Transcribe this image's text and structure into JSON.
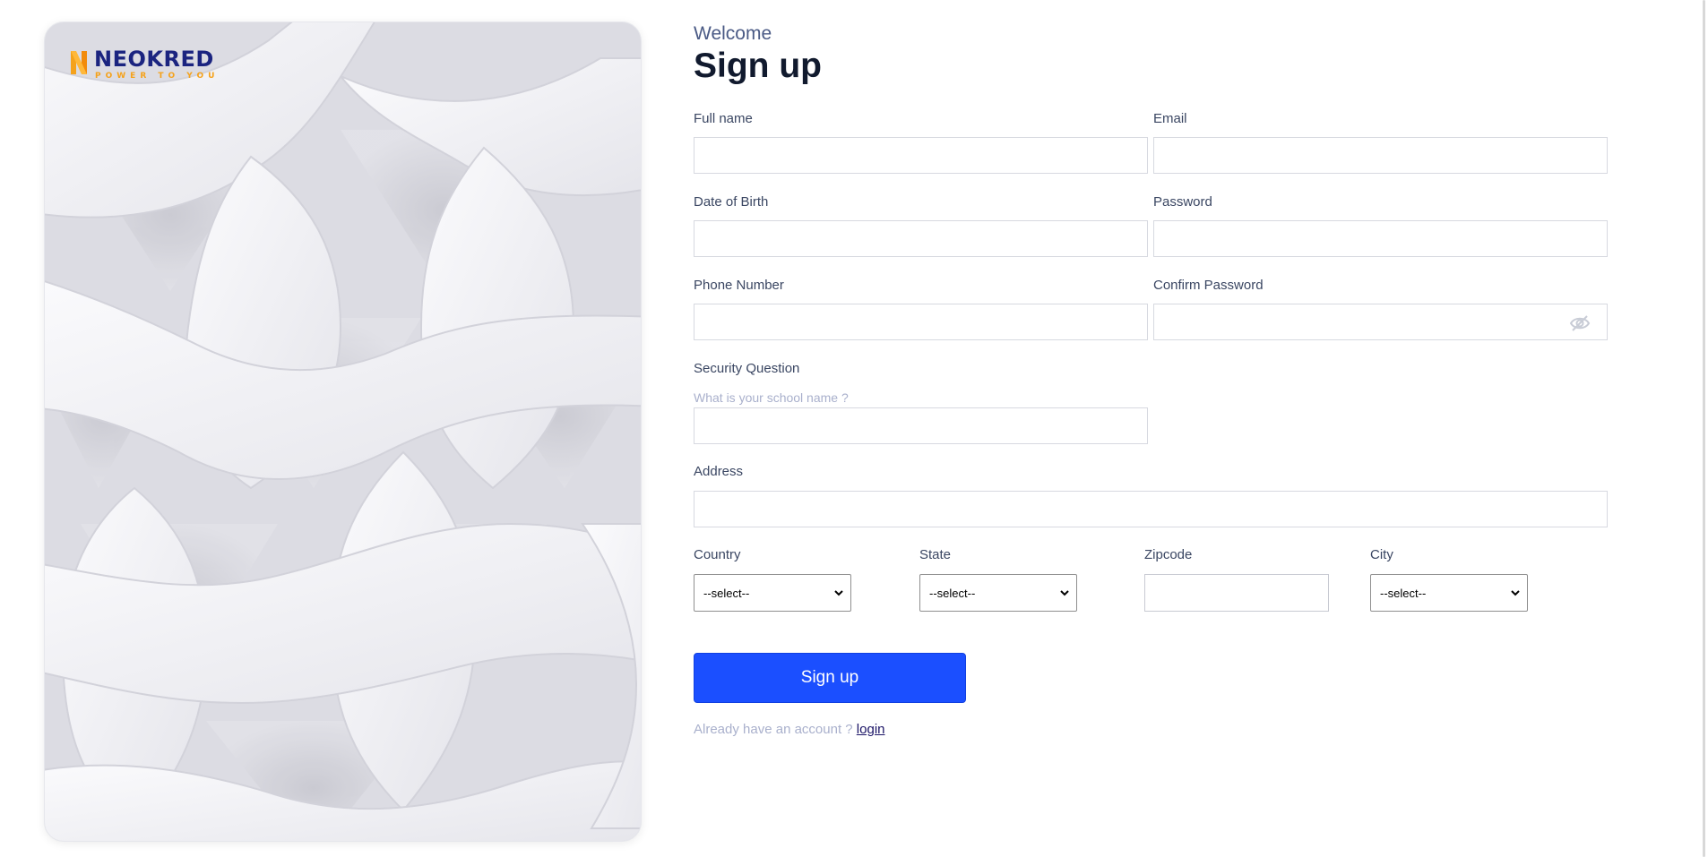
{
  "brand": {
    "name": "NEOKRED",
    "tagline": "POWER TO YOU",
    "color_primary": "#1b2480",
    "color_accent": "#f5a21b"
  },
  "header": {
    "welcome": "Welcome",
    "title": "Sign up"
  },
  "fields": {
    "full_name": {
      "label": "Full name",
      "value": ""
    },
    "email": {
      "label": "Email",
      "value": ""
    },
    "dob": {
      "label": "Date of Birth",
      "value": ""
    },
    "password": {
      "label": "Password",
      "value": ""
    },
    "phone": {
      "label": "Phone Number",
      "value": ""
    },
    "confirm_password": {
      "label": "Confirm Password",
      "value": "",
      "icon": "eye-off-icon"
    },
    "security": {
      "label": "Security Question",
      "question": "What is your school name ?",
      "value": ""
    },
    "address": {
      "label": "Address",
      "value": ""
    },
    "country": {
      "label": "Country",
      "selected": "--select--"
    },
    "state": {
      "label": "State",
      "selected": "--select--"
    },
    "zipcode": {
      "label": "Zipcode",
      "value": ""
    },
    "city": {
      "label": "City",
      "selected": "--select--"
    }
  },
  "actions": {
    "submit_label": "Sign up",
    "submit_color": "#1b4fff",
    "login_prompt": "Already have an account ?",
    "login_link": "login"
  }
}
